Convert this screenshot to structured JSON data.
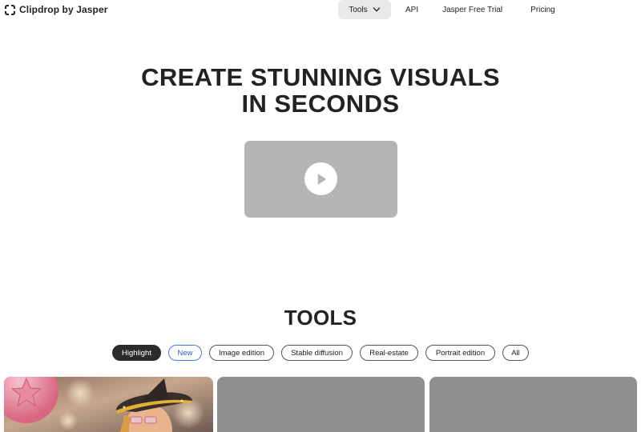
{
  "header": {
    "brand": "Clipdrop by Jasper",
    "nav": {
      "tools": "Tools",
      "api": "API",
      "trial": "Jasper Free Trial",
      "pricing": "Pricing"
    }
  },
  "hero": {
    "title_line1": "CREATE STUNNING VISUALS",
    "title_line2": "IN SECONDS"
  },
  "tools": {
    "title": "TOOLS",
    "filters": [
      "Highlight",
      "New",
      "Image edition",
      "Stable diffusion",
      "Real-estate",
      "Portrait edition",
      "All"
    ],
    "active_filter": "Highlight"
  },
  "colors": {
    "text": "#222222",
    "chip_active": "#2b2b2b",
    "chip_new": "#2f5fc2",
    "video_placeholder": "#b5b5b5",
    "card_placeholder": "#8f8f8f"
  }
}
